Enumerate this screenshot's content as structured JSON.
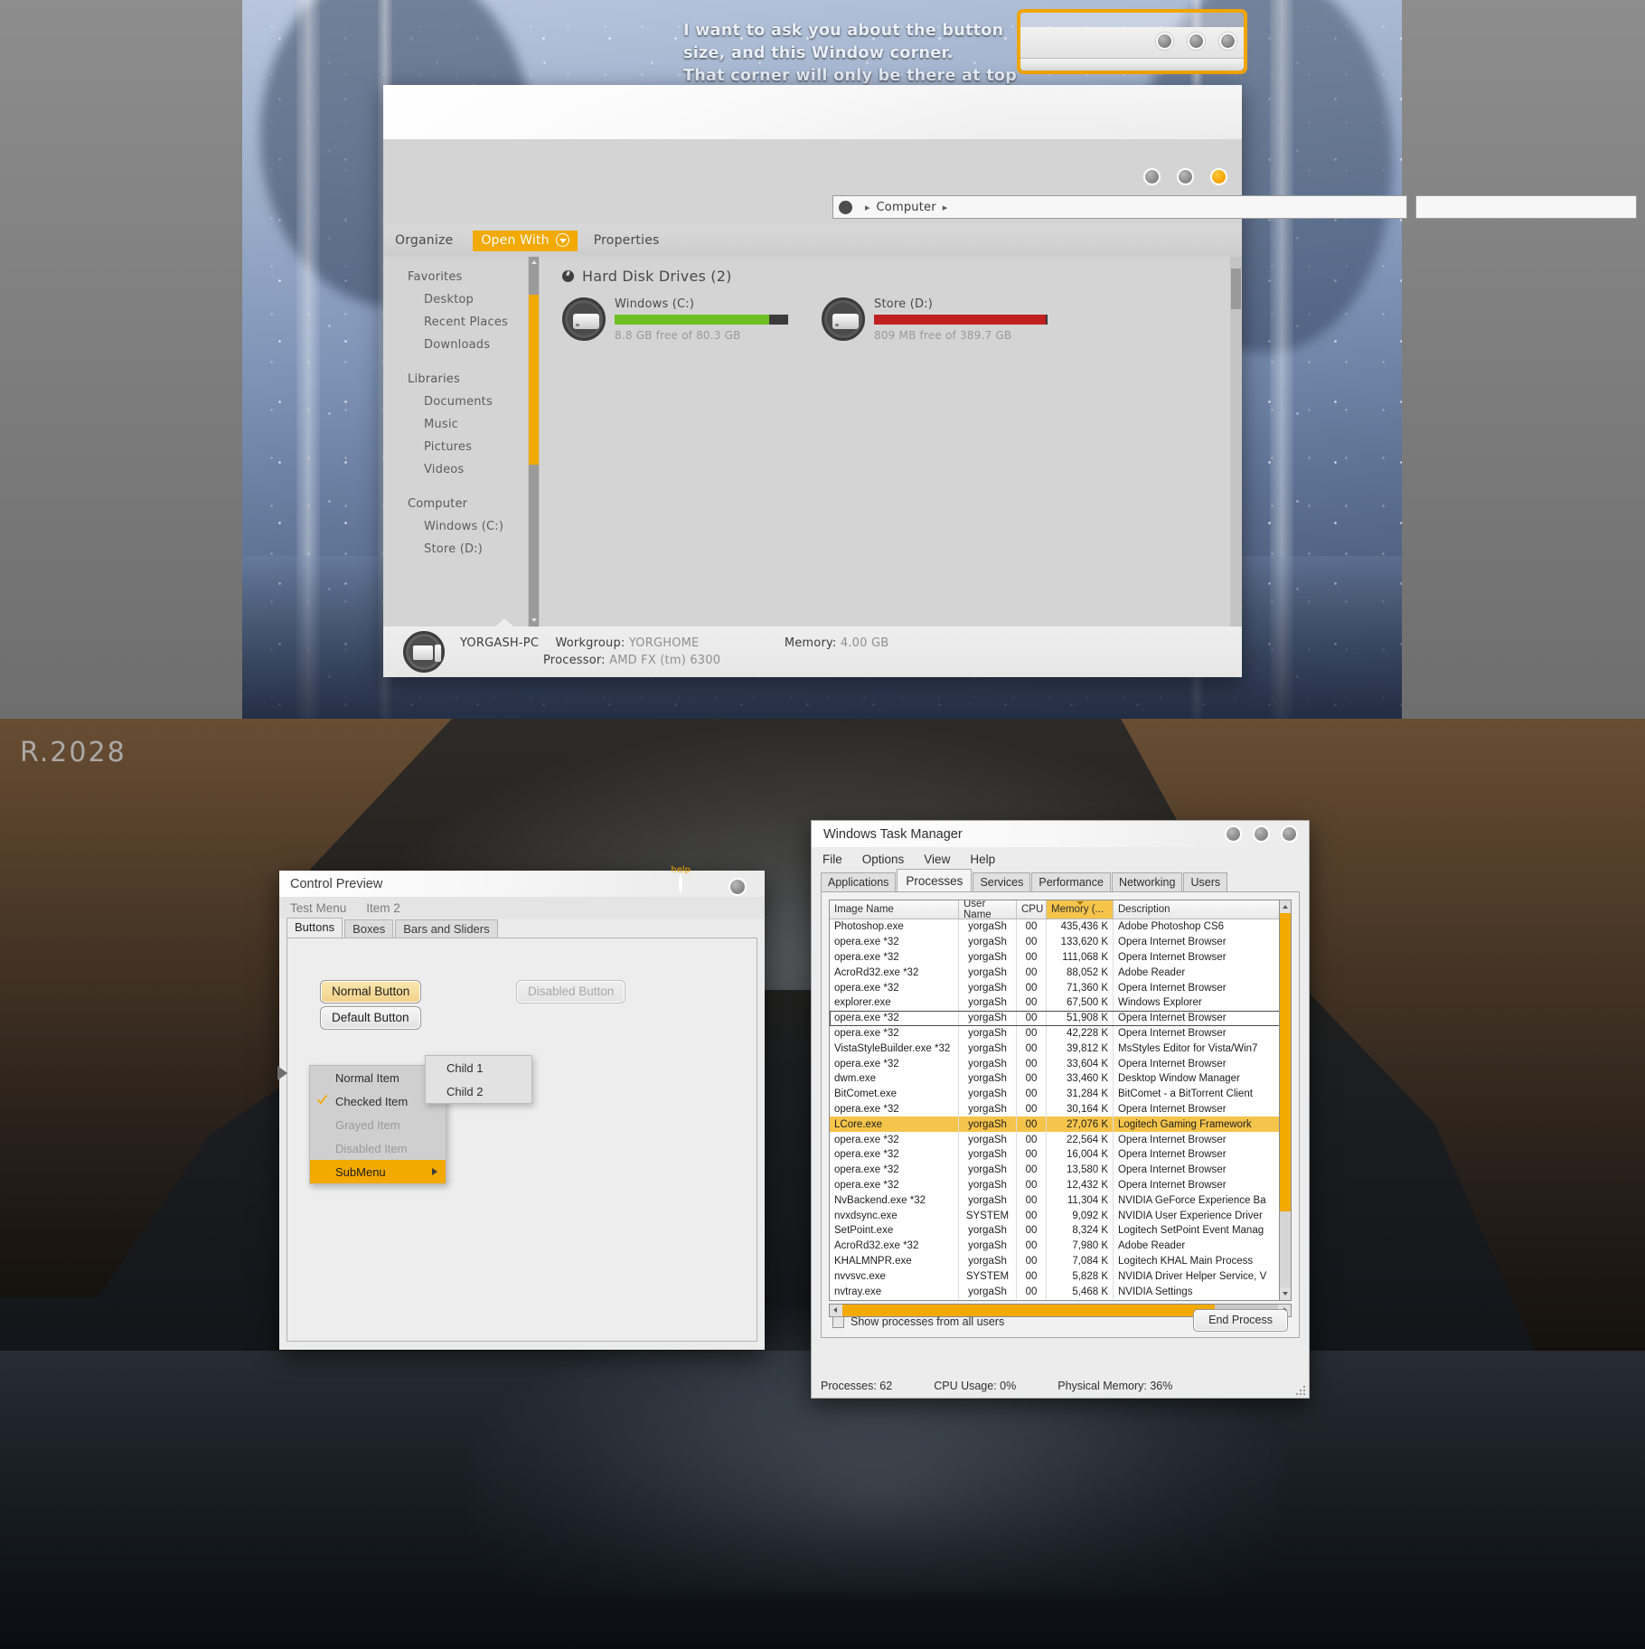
{
  "top_scene": {
    "callout": "I want to ask you about the button size, and this Window corner. That corner will only be there at top right.",
    "callout_lines": [
      "I want to ask you about the button",
      "size, and this Window corner.",
      "That corner will only be there at top right."
    ],
    "highlight_color": "#f0a500"
  },
  "explorer": {
    "address": {
      "crumb": "Computer",
      "placeholder": ""
    },
    "search": {
      "value": "",
      "placeholder": ""
    },
    "toolbar": {
      "organize": "Organize",
      "open_with": "Open With",
      "properties": "Properties"
    },
    "nav": [
      {
        "label": "Favorites",
        "type": "head"
      },
      {
        "label": "Desktop",
        "type": "sub"
      },
      {
        "label": "Recent Places",
        "type": "sub"
      },
      {
        "label": "Downloads",
        "type": "sub"
      },
      {
        "label": "",
        "type": "gap"
      },
      {
        "label": "Libraries",
        "type": "head"
      },
      {
        "label": "Documents",
        "type": "sub"
      },
      {
        "label": "Music",
        "type": "sub"
      },
      {
        "label": "Pictures",
        "type": "sub"
      },
      {
        "label": "Videos",
        "type": "sub"
      },
      {
        "label": "",
        "type": "gap"
      },
      {
        "label": "Computer",
        "type": "head"
      },
      {
        "label": "Windows (C:)",
        "type": "sub"
      },
      {
        "label": "Store (D:)",
        "type": "sub"
      }
    ],
    "group_title": "Hard Disk Drives (2)",
    "drives": [
      {
        "name": "Windows (C:)",
        "free_text": "8.8 GB free of 80.3 GB",
        "used_percent": 89,
        "bar_color": "#6cc024"
      },
      {
        "name": "Store (D:)",
        "free_text": "809 MB free of 389.7 GB",
        "used_percent": 99,
        "bar_color": "#c02020"
      }
    ],
    "status": {
      "computer_name": "YORGASH-PC",
      "workgroup_key": "Workgroup:",
      "workgroup_value": "YORGHOME",
      "memory_key": "Memory:",
      "memory_value": "4.00 GB",
      "processor_key": "Processor:",
      "processor_value": "AMD FX (tm) 6300"
    }
  },
  "bottom_scene": {
    "revision_label": "R.2028"
  },
  "control_preview": {
    "title": "Control Preview",
    "help_label": "help",
    "menu": [
      "Test Menu",
      "Item 2"
    ],
    "tabs": [
      {
        "label": "Buttons",
        "active": true
      },
      {
        "label": "Boxes",
        "active": false
      },
      {
        "label": "Bars and Sliders",
        "active": false
      }
    ],
    "buttons": {
      "normal": "Normal Button",
      "default": "Default Button",
      "disabled": "Disabled Button"
    },
    "context_menu": [
      {
        "label": "Normal Item",
        "state": "normal"
      },
      {
        "label": "Checked Item",
        "state": "checked"
      },
      {
        "label": "Grayed Item",
        "state": "grayed"
      },
      {
        "label": "Disabled Item",
        "state": "disabled"
      },
      {
        "label": "SubMenu",
        "state": "selected",
        "has_submenu": true
      }
    ],
    "submenu": [
      "Child 1",
      "Child 2"
    ]
  },
  "task_manager": {
    "title": "Windows Task Manager",
    "menu": [
      "File",
      "Options",
      "View",
      "Help"
    ],
    "tabs": [
      {
        "label": "Applications",
        "active": false
      },
      {
        "label": "Processes",
        "active": true
      },
      {
        "label": "Services",
        "active": false
      },
      {
        "label": "Performance",
        "active": false
      },
      {
        "label": "Networking",
        "active": false
      },
      {
        "label": "Users",
        "active": false
      }
    ],
    "columns": [
      "Image Name",
      "User Name",
      "CPU",
      "Memory (...",
      "Description"
    ],
    "sorted_column": "Memory (...",
    "rows": [
      {
        "image": "Photoshop.exe",
        "user": "yorgaSh",
        "cpu": "00",
        "mem": "435,436 K",
        "desc": "Adobe Photoshop CS6",
        "state": "normal"
      },
      {
        "image": "opera.exe *32",
        "user": "yorgaSh",
        "cpu": "00",
        "mem": "133,620 K",
        "desc": "Opera Internet Browser",
        "state": "normal"
      },
      {
        "image": "opera.exe *32",
        "user": "yorgaSh",
        "cpu": "00",
        "mem": "111,068 K",
        "desc": "Opera Internet Browser",
        "state": "normal"
      },
      {
        "image": "AcroRd32.exe *32",
        "user": "yorgaSh",
        "cpu": "00",
        "mem": "88,052 K",
        "desc": "Adobe Reader",
        "state": "normal"
      },
      {
        "image": "opera.exe *32",
        "user": "yorgaSh",
        "cpu": "00",
        "mem": "71,360 K",
        "desc": "Opera Internet Browser",
        "state": "normal"
      },
      {
        "image": "explorer.exe",
        "user": "yorgaSh",
        "cpu": "00",
        "mem": "67,500 K",
        "desc": "Windows Explorer",
        "state": "normal"
      },
      {
        "image": "opera.exe *32",
        "user": "yorgaSh",
        "cpu": "00",
        "mem": "51,908 K",
        "desc": "Opera Internet Browser",
        "state": "focused"
      },
      {
        "image": "opera.exe *32",
        "user": "yorgaSh",
        "cpu": "00",
        "mem": "42,228 K",
        "desc": "Opera Internet Browser",
        "state": "normal"
      },
      {
        "image": "VistaStyleBuilder.exe *32",
        "user": "yorgaSh",
        "cpu": "00",
        "mem": "39,812 K",
        "desc": "MsStyles Editor for Vista/Win7",
        "state": "normal"
      },
      {
        "image": "opera.exe *32",
        "user": "yorgaSh",
        "cpu": "00",
        "mem": "33,604 K",
        "desc": "Opera Internet Browser",
        "state": "normal"
      },
      {
        "image": "dwm.exe",
        "user": "yorgaSh",
        "cpu": "00",
        "mem": "33,460 K",
        "desc": "Desktop Window Manager",
        "state": "normal"
      },
      {
        "image": "BitComet.exe",
        "user": "yorgaSh",
        "cpu": "00",
        "mem": "31,284 K",
        "desc": "BitComet - a BitTorrent Client",
        "state": "normal"
      },
      {
        "image": "opera.exe *32",
        "user": "yorgaSh",
        "cpu": "00",
        "mem": "30,164 K",
        "desc": "Opera Internet Browser",
        "state": "normal"
      },
      {
        "image": "LCore.exe",
        "user": "yorgaSh",
        "cpu": "00",
        "mem": "27,076 K",
        "desc": "Logitech Gaming Framework",
        "state": "selected"
      },
      {
        "image": "opera.exe *32",
        "user": "yorgaSh",
        "cpu": "00",
        "mem": "22,564 K",
        "desc": "Opera Internet Browser",
        "state": "normal"
      },
      {
        "image": "opera.exe *32",
        "user": "yorgaSh",
        "cpu": "00",
        "mem": "16,004 K",
        "desc": "Opera Internet Browser",
        "state": "normal"
      },
      {
        "image": "opera.exe *32",
        "user": "yorgaSh",
        "cpu": "00",
        "mem": "13,580 K",
        "desc": "Opera Internet Browser",
        "state": "normal"
      },
      {
        "image": "opera.exe *32",
        "user": "yorgaSh",
        "cpu": "00",
        "mem": "12,432 K",
        "desc": "Opera Internet Browser",
        "state": "normal"
      },
      {
        "image": "NvBackend.exe *32",
        "user": "yorgaSh",
        "cpu": "00",
        "mem": "11,304 K",
        "desc": "NVIDIA GeForce Experience Ba",
        "state": "normal"
      },
      {
        "image": "nvxdsync.exe",
        "user": "SYSTEM",
        "cpu": "00",
        "mem": "9,092 K",
        "desc": "NVIDIA User Experience Driver",
        "state": "normal"
      },
      {
        "image": "SetPoint.exe",
        "user": "yorgaSh",
        "cpu": "00",
        "mem": "8,324 K",
        "desc": "Logitech SetPoint Event Manag",
        "state": "normal"
      },
      {
        "image": "AcroRd32.exe *32",
        "user": "yorgaSh",
        "cpu": "00",
        "mem": "7,980 K",
        "desc": "Adobe Reader",
        "state": "normal"
      },
      {
        "image": "KHALMNPR.exe",
        "user": "yorgaSh",
        "cpu": "00",
        "mem": "7,084 K",
        "desc": "Logitech KHAL Main Process",
        "state": "normal"
      },
      {
        "image": "nvvsvc.exe",
        "user": "SYSTEM",
        "cpu": "00",
        "mem": "5,828 K",
        "desc": "NVIDIA Driver Helper Service, V",
        "state": "normal"
      },
      {
        "image": "nvtray.exe",
        "user": "yorgaSh",
        "cpu": "00",
        "mem": "5,468 K",
        "desc": "NVIDIA Settings",
        "state": "normal"
      }
    ],
    "show_all_users": "Show processes from all users",
    "end_process": "End Process",
    "status": {
      "processes": "Processes: 62",
      "cpu_usage": "CPU Usage: 0%",
      "physical_memory": "Physical Memory: 36%"
    }
  }
}
